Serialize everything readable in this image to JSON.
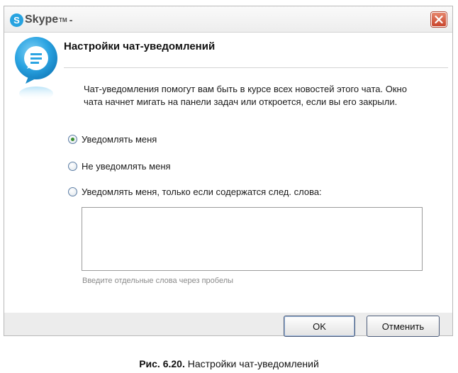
{
  "window": {
    "app_name": "Skype",
    "app_tm": "TM",
    "title_suffix": "-"
  },
  "icons": {
    "app_logo": "skype-logo-icon",
    "close": "close-icon",
    "header": "chat-bubble-icon"
  },
  "header": {
    "title": "Настройки чат-уведомлений"
  },
  "description": {
    "line1": "Чат-уведомления помогут вам быть в курсе всех новостей этого чата. Окно",
    "line2": "чата начнет мигать на панели задач или откроется, если вы его закрыли."
  },
  "options": [
    {
      "label": "Уведомлять меня",
      "checked": true
    },
    {
      "label": "Не уведомлять меня",
      "checked": false
    },
    {
      "label": "Уведомлять меня, только если содержатся след. слова:",
      "checked": false
    }
  ],
  "keywords_field": {
    "value": ""
  },
  "hint": "Введите отдельные слова через пробелы",
  "buttons": {
    "ok": "OK",
    "cancel": "Отменить"
  },
  "caption": {
    "figure": "Рис. 6.20.",
    "text": "Настройки чат-уведомлений"
  },
  "colors": {
    "skype_blue": "#27a3e0",
    "close_red": "#c9452d",
    "radio_checked": "#3a8f2f"
  }
}
